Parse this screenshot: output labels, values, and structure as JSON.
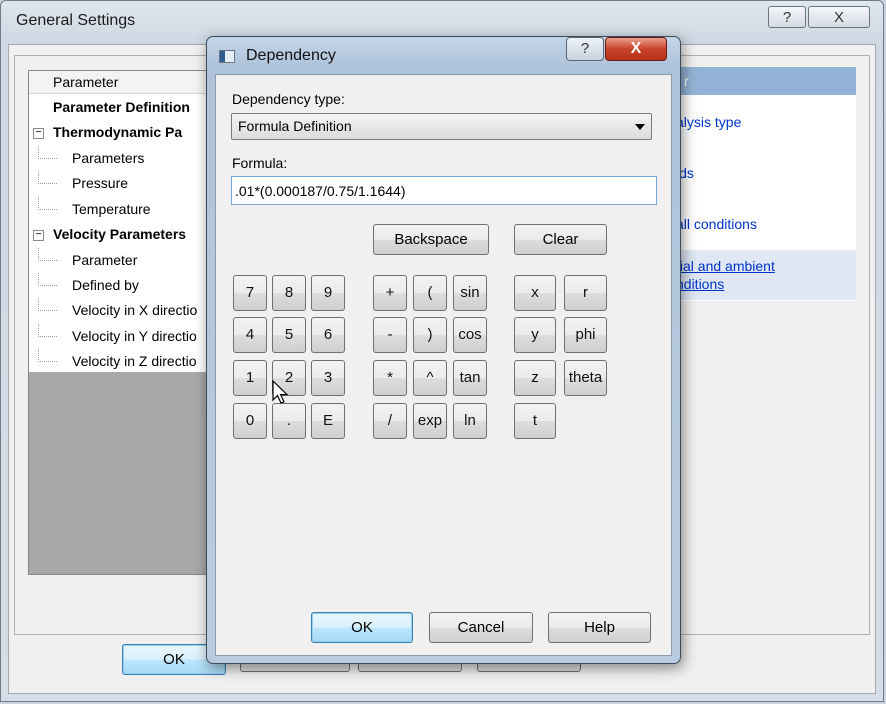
{
  "general_settings": {
    "title": "General Settings",
    "help_glyph": "?",
    "close_glyph": "X",
    "tree": {
      "header": "Parameter",
      "rows": [
        {
          "label": "Parameter Definition",
          "bold": true
        },
        {
          "label": "Thermodynamic Pa",
          "bold": true,
          "expander": "−"
        },
        {
          "label": "Parameters"
        },
        {
          "label": "Pressure"
        },
        {
          "label": "Temperature"
        },
        {
          "label": "Velocity Parameters",
          "bold": true,
          "expander": "−"
        },
        {
          "label": "Parameter"
        },
        {
          "label": "Defined by"
        },
        {
          "label": "Velocity in X directio"
        },
        {
          "label": "Velocity in Y directio"
        },
        {
          "label": "Velocity in Z directio"
        }
      ]
    },
    "right_panel": {
      "header": "r",
      "links": [
        "alysis type",
        "ids",
        "all conditions",
        "tial and ambient",
        "nditions"
      ]
    },
    "ok_label": "OK"
  },
  "dependency_dialog": {
    "title": "Dependency",
    "help_glyph": "?",
    "close_glyph": "X",
    "dependency_type_label": "Dependency type:",
    "dependency_type_value": "Formula Definition",
    "formula_label": "Formula:",
    "formula_value": ".01*(0.000187/0.75/1.1644)",
    "backspace_label": "Backspace",
    "clear_label": "Clear",
    "digits": [
      "7",
      "8",
      "9",
      "4",
      "5",
      "6",
      "1",
      "2",
      "3",
      "0",
      ".",
      "E"
    ],
    "operators": [
      "+",
      "(",
      "sin",
      "-",
      ")",
      "cos",
      "*",
      "^",
      "tan",
      "/",
      "exp",
      "ln"
    ],
    "variables": [
      "x",
      "r",
      "y",
      "phi",
      "z",
      "theta",
      "t"
    ],
    "ok_label": "OK",
    "cancel_label": "Cancel",
    "help_label": "Help"
  }
}
